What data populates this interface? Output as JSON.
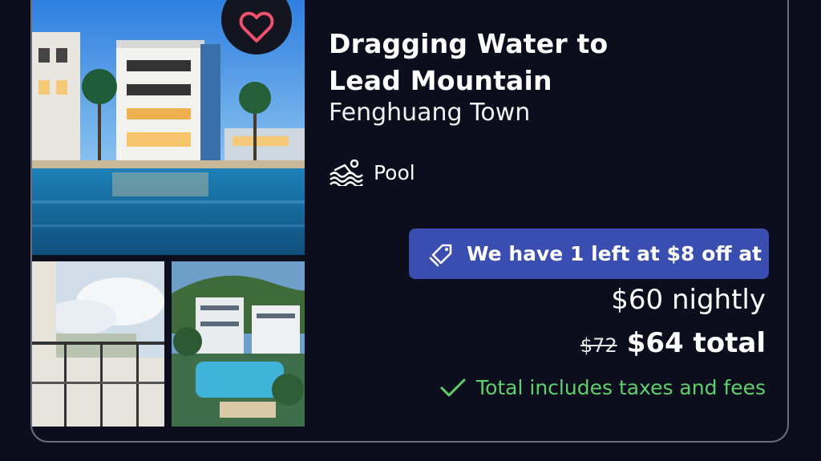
{
  "hotel": {
    "title_line1": "Dragging Water to",
    "title_line2": "Lead Mountain",
    "location": "Fenghuang Town",
    "amenity": "Pool",
    "amenity_icon": "swimming-pool-icon"
  },
  "deal": {
    "text": "We have 1 left at $8 off at",
    "icon": "price-tag-icon"
  },
  "pricing": {
    "nightly": "$60 nightly",
    "old_price": "$72",
    "total": "$64 total",
    "taxes_note": "Total includes taxes and fees"
  },
  "favorite": {
    "icon": "heart-icon"
  },
  "colors": {
    "background": "#0d0e1d",
    "deal_badge": "#3a4db1",
    "heart": "#f0506e",
    "taxes_green": "#5ed16e"
  }
}
